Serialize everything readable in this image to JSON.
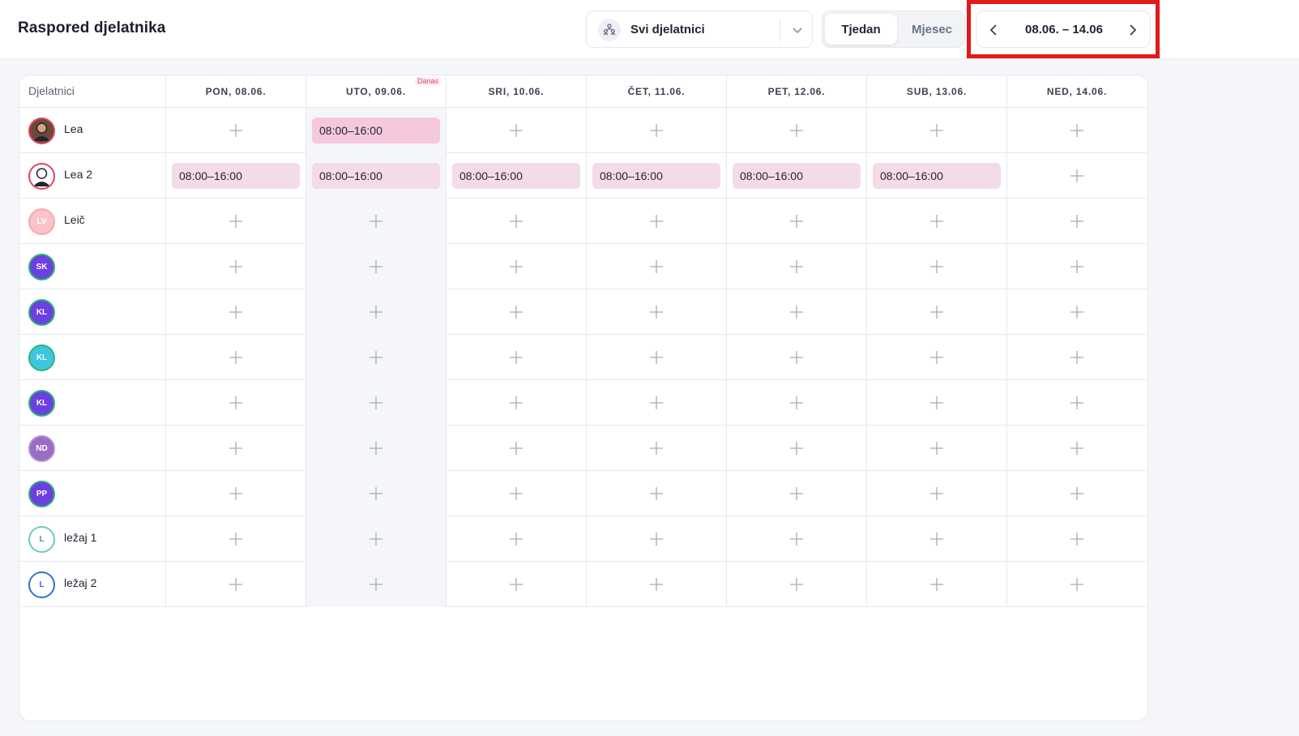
{
  "header": {
    "title": "Raspored djelatnika",
    "employee_filter": {
      "selected": "Svi djelatnici",
      "icon": "people-group-icon"
    },
    "view_toggle": {
      "week": "Tjedan",
      "month": "Mjesec",
      "active": "week"
    },
    "date_range": {
      "label": "08.06. – 14.06",
      "prev_icon": "chevron-left-icon",
      "next_icon": "chevron-right-icon"
    }
  },
  "grid": {
    "employee_header": "Djelatnici",
    "days": [
      {
        "label": "PON, 08.06.",
        "badge": ""
      },
      {
        "label": "UTO, 09.06.",
        "badge": "Danas"
      },
      {
        "label": "SRI, 10.06.",
        "badge": ""
      },
      {
        "label": "ČET, 11.06.",
        "badge": ""
      },
      {
        "label": "PET, 12.06.",
        "badge": ""
      },
      {
        "label": "SUB, 13.06.",
        "badge": ""
      },
      {
        "label": "NED, 14.06.",
        "badge": ""
      }
    ],
    "today_index": 1,
    "employees": [
      {
        "name": "Lea",
        "initials": "",
        "avatar_bg": "#6b4a3a",
        "ring": "#e0445f",
        "initials_color": "#ffffff",
        "shifts": [
          "",
          "08:00–16:00",
          "",
          "",
          "",
          "",
          ""
        ]
      },
      {
        "name": "Lea 2",
        "initials": "",
        "avatar_bg": "#ffffff",
        "ring": "#e0445f",
        "initials_color": "#1f2430",
        "shifts": [
          "08:00–16:00",
          "08:00–16:00",
          "08:00–16:00",
          "08:00–16:00",
          "08:00–16:00",
          "08:00–16:00",
          ""
        ]
      },
      {
        "name": "Leič",
        "initials": "LV",
        "avatar_bg": "#f9c3c8",
        "ring": "#f7a9b1",
        "initials_color": "#ffffff",
        "shifts": [
          "",
          "",
          "",
          "",
          "",
          "",
          ""
        ]
      },
      {
        "name": "",
        "initials": "SK",
        "avatar_bg": "#6c3fe0",
        "ring": "#2bb673",
        "initials_color": "#ffffff",
        "shifts": [
          "",
          "",
          "",
          "",
          "",
          "",
          ""
        ]
      },
      {
        "name": "",
        "initials": "KL",
        "avatar_bg": "#6c3fe0",
        "ring": "#2bb673",
        "initials_color": "#ffffff",
        "shifts": [
          "",
          "",
          "",
          "",
          "",
          "",
          ""
        ]
      },
      {
        "name": "",
        "initials": "KL",
        "avatar_bg": "#3cc6e0",
        "ring": "#2bb673",
        "initials_color": "#ffffff",
        "shifts": [
          "",
          "",
          "",
          "",
          "",
          "",
          ""
        ]
      },
      {
        "name": "",
        "initials": "KL",
        "avatar_bg": "#6c3fe0",
        "ring": "#2bb673",
        "initials_color": "#ffffff",
        "shifts": [
          "",
          "",
          "",
          "",
          "",
          "",
          ""
        ]
      },
      {
        "name": "",
        "initials": "ND",
        "avatar_bg": "#9a6cc4",
        "ring": "#b393d8",
        "initials_color": "#ffffff",
        "shifts": [
          "",
          "",
          "",
          "",
          "",
          "",
          ""
        ]
      },
      {
        "name": "",
        "initials": "PP",
        "avatar_bg": "#6c3fe0",
        "ring": "#2bb673",
        "initials_color": "#ffffff",
        "shifts": [
          "",
          "",
          "",
          "",
          "",
          "",
          ""
        ]
      },
      {
        "name": "ležaj 1",
        "initials": "L",
        "avatar_bg": "#ffffff",
        "ring": "#6fc8c0",
        "initials_color": "#3a9e95",
        "shifts": [
          "",
          "",
          "",
          "",
          "",
          "",
          ""
        ]
      },
      {
        "name": "ležaj 2",
        "initials": "L",
        "avatar_bg": "#ffffff",
        "ring": "#2f6fd6",
        "initials_color": "#2f6fd6",
        "shifts": [
          "",
          "",
          "",
          "",
          "",
          "",
          ""
        ]
      }
    ]
  },
  "colors": {
    "highlight": "#e01b1b",
    "shift": "#f3dbe7",
    "shift_strong": "#f6c8dd",
    "today_column": "#f4f6fa"
  }
}
